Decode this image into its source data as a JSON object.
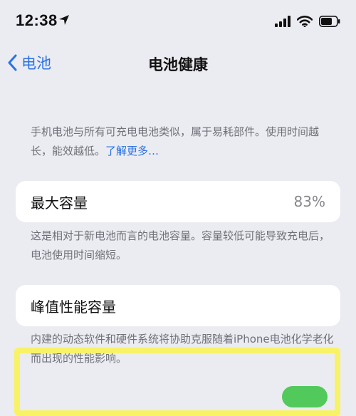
{
  "status_bar": {
    "time": "12:38",
    "icons": [
      "location-arrow-icon",
      "signal-icon",
      "wifi-icon",
      "battery-icon"
    ]
  },
  "nav": {
    "back_label": "电池",
    "title": "电池健康"
  },
  "intro": {
    "text": "手机电池与所有可充电电池类似，属于易耗部件。使用时间越长，能效越低。",
    "link": "了解更多…"
  },
  "max_capacity": {
    "label": "最大容量",
    "value": "83%",
    "note": "这是相对于新电池而言的电池容量。容量较低可能导致充电后，电池使用时间缩短。"
  },
  "peak_performance": {
    "label": "峰值性能容量",
    "note": "内建的动态软件和硬件系统将协助克服随着iPhone电池化学老化而出现的性能影响。"
  },
  "colors": {
    "background": "#ebebf2",
    "accent": "#2a73e6",
    "toggle_on": "#52c95b",
    "highlight": "#f8f35a"
  }
}
